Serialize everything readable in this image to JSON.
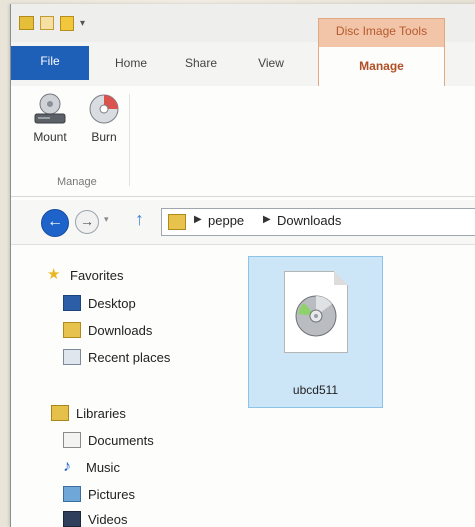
{
  "title_bar": {
    "context_tab_header": "Disc Image Tools"
  },
  "tabs": {
    "file": "File",
    "home": "Home",
    "share": "Share",
    "view": "View",
    "manage": "Manage"
  },
  "ribbon": {
    "mount_label": "Mount",
    "burn_label": "Burn",
    "group_label": "Manage"
  },
  "address_bar": {
    "segments": [
      "peppe",
      "Downloads"
    ]
  },
  "nav_pane": {
    "favorites": {
      "label": "Favorites",
      "items": [
        "Desktop",
        "Downloads",
        "Recent places"
      ]
    },
    "libraries": {
      "label": "Libraries",
      "items": [
        "Documents",
        "Music",
        "Pictures",
        "Videos"
      ]
    }
  },
  "content": {
    "selected_file_name": "ubcd511"
  },
  "colors": {
    "file_tab": "#1e5fb8",
    "context_tab": "#f3c5a8",
    "context_text": "#b04f25",
    "selection": "#cde6f7"
  },
  "icons": {
    "back": "back-arrow-icon",
    "forward": "forward-arrow-icon",
    "up": "up-arrow-icon",
    "mount": "mount-drive-icon",
    "burn": "burn-disc-icon",
    "file": "disc-image-file-icon"
  }
}
